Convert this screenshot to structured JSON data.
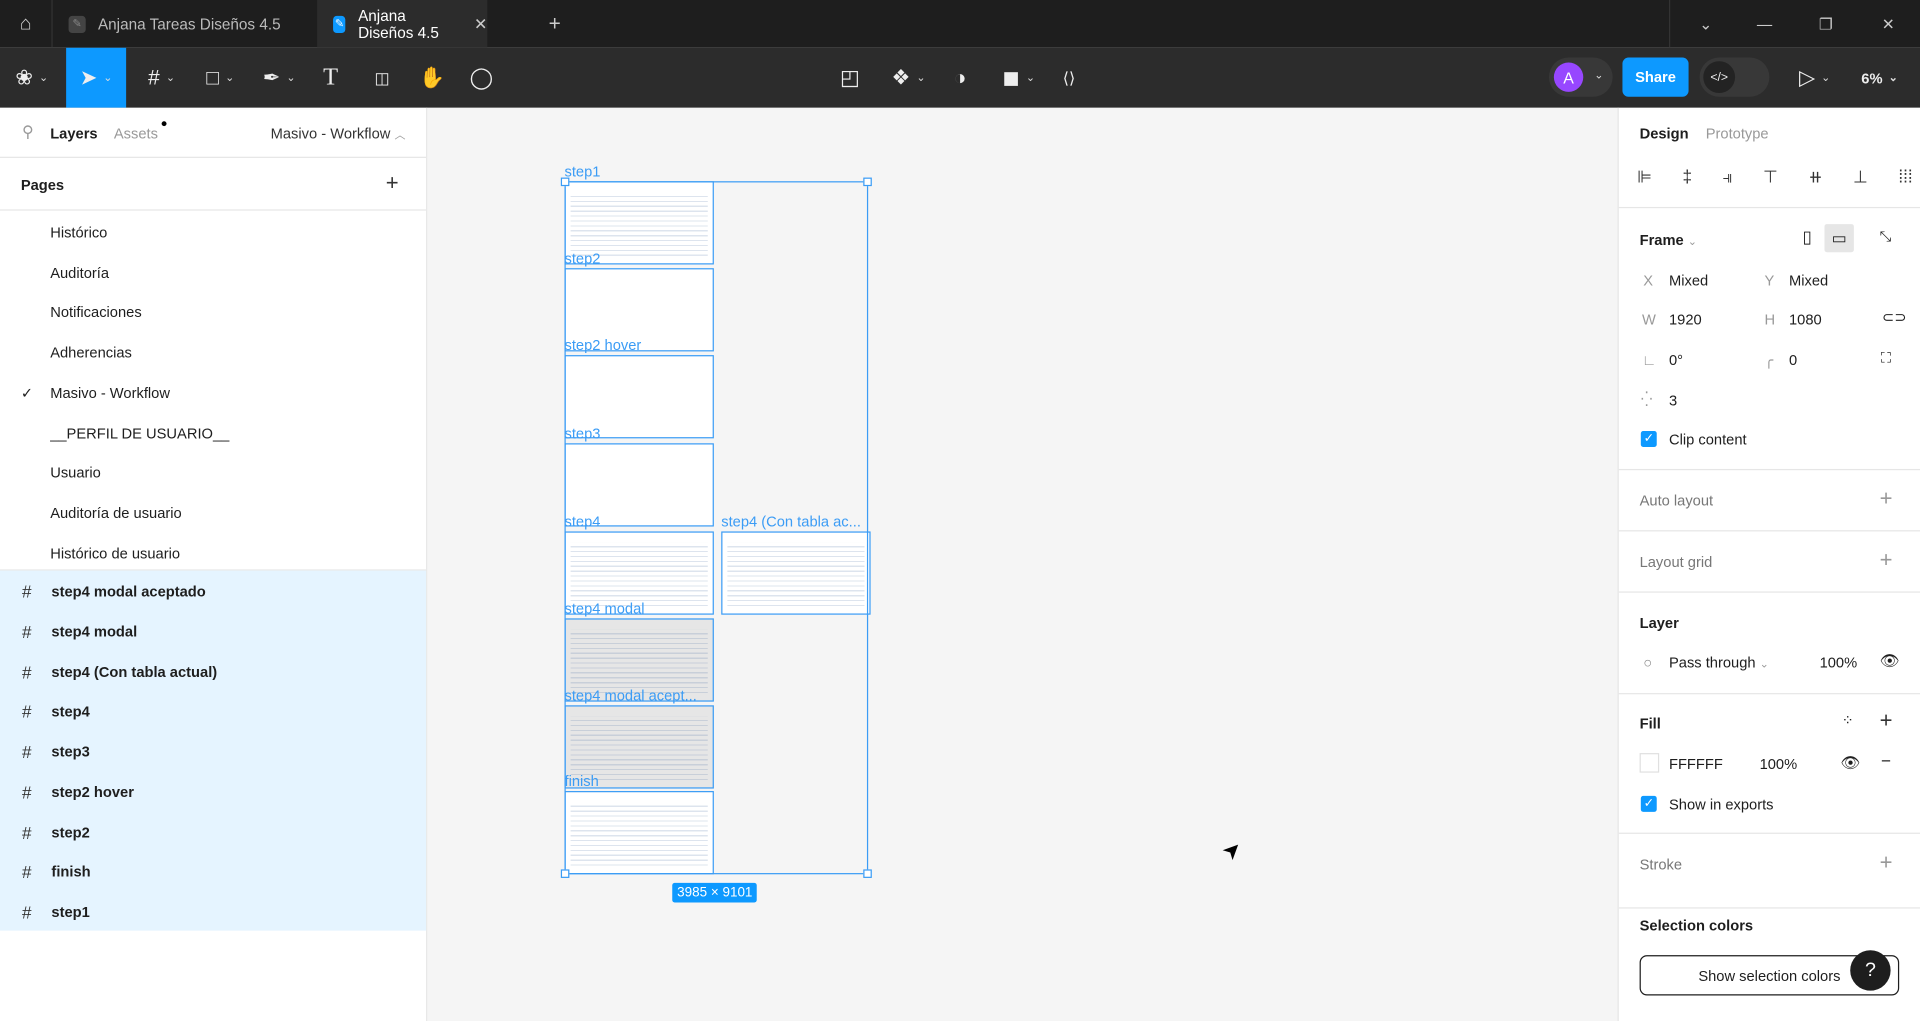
{
  "tabs": [
    {
      "label": "Anjana Tareas Diseños 4.5",
      "active": false
    },
    {
      "label": "Anjana Diseños 4.5",
      "active": true
    }
  ],
  "toolbar": {
    "share_label": "Share",
    "avatar_initial": "A",
    "zoom": "6%",
    "dev_mode_icon": "</>"
  },
  "left_panel": {
    "layers_tab": "Layers",
    "assets_tab": "Assets",
    "current_page": "Masivo - Workflow",
    "pages_header": "Pages",
    "pages": [
      "Histórico",
      "Auditoría",
      "Notificaciones",
      "Adherencias",
      "Masivo - Workflow",
      "__PERFIL DE USUARIO__",
      "Usuario",
      "Auditoría de usuario",
      "Histórico de usuario"
    ],
    "selected_page_index": 4,
    "layers": [
      "step4 modal aceptado",
      "step4 modal",
      "step4 (Con tabla actual)",
      "step4",
      "step3",
      "step2 hover",
      "step2",
      "finish",
      "step1"
    ]
  },
  "canvas": {
    "frames": [
      "step1",
      "step2",
      "step2 hover",
      "step3",
      "step4",
      "step4 modal",
      "step4 modal acept...",
      "finish",
      "step4 (Con tabla ac..."
    ],
    "selection_size": "3985 × 9101"
  },
  "right_panel": {
    "design_tab": "Design",
    "prototype_tab": "Prototype",
    "frame_label": "Frame",
    "x_label": "X",
    "x_value": "Mixed",
    "y_label": "Y",
    "y_value": "Mixed",
    "w_label": "W",
    "w_value": "1920",
    "h_label": "H",
    "h_value": "1080",
    "rotation": "0°",
    "radius": "0",
    "clip_count": "3",
    "clip_content": "Clip content",
    "auto_layout": "Auto layout",
    "layout_grid": "Layout grid",
    "layer_label": "Layer",
    "blend_mode": "Pass through",
    "layer_opacity": "100%",
    "fill_label": "Fill",
    "fill_hex": "FFFFFF",
    "fill_opacity": "100%",
    "show_in_exports": "Show in exports",
    "stroke_label": "Stroke",
    "selection_colors_label": "Selection colors",
    "show_selection_colors": "Show selection colors",
    "help": "?"
  },
  "colors": {
    "accent": "#0d99ff",
    "selection": "#3b9cf5",
    "avatar": "#9747ff",
    "toolbar": "#2c2c2c"
  }
}
